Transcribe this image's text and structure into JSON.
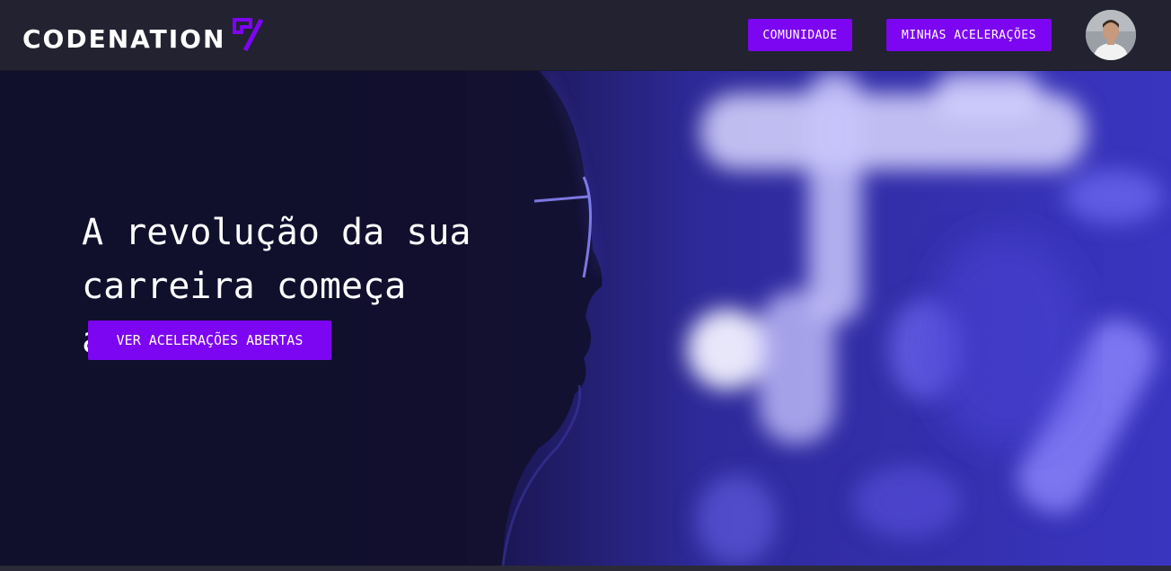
{
  "navbar": {
    "logo_text": "CODENATION",
    "logo_icon": "codenation-mark-icon",
    "community_label": "COMUNIDADE",
    "accelerations_label": "MINHAS ACELERAÇÕES",
    "avatar_icon": "user-avatar"
  },
  "hero": {
    "title": "A revolução da sua carreira começa agora.",
    "cta_label": "VER ACELERAÇÕES ABERTAS"
  },
  "colors": {
    "accent": "#7c05f2",
    "navbar_bg": "#222231",
    "hero_bg": "#15133a",
    "glow": "#8a80ff"
  }
}
